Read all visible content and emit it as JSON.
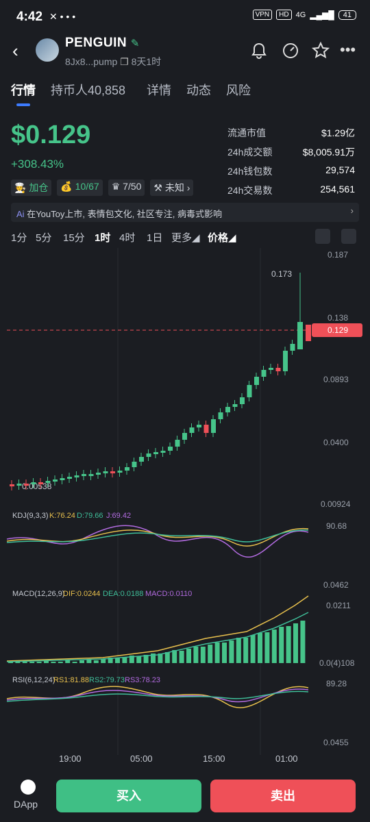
{
  "status": {
    "time": "4:42",
    "vpn": "VPN",
    "hd": "HD",
    "net": "4G",
    "battery": "41"
  },
  "token": {
    "name": "PENGUIN",
    "address": "8Jx8...pump",
    "age": "8天1时"
  },
  "tabs": [
    "行情",
    "持币人40,858",
    "详情",
    "动态",
    "风险"
  ],
  "price": {
    "value": "$0.129",
    "change": "+308.43%"
  },
  "badges": [
    "加仓",
    "10/67",
    "7/50",
    "未知"
  ],
  "stats": [
    {
      "label": "流通市值",
      "value": "$1.29亿"
    },
    {
      "label": "24h成交额",
      "value": "$8,005.91万"
    },
    {
      "label": "24h钱包数",
      "value": "29,574"
    },
    {
      "label": "24h交易数",
      "value": "254,561"
    }
  ],
  "ai_text": "在YouToy上市, 表情包文化, 社区专注, 病毒式影响",
  "timeframes": [
    "1分",
    "5分",
    "15分",
    "1时",
    "4时",
    "1日",
    "更多",
    "价格"
  ],
  "chart_data": {
    "type": "candlestick",
    "price_axis": [
      "0.187",
      "0.138",
      "0.0893",
      "0.0400",
      "0.00924"
    ],
    "current_price": "0.129",
    "high_label": "0.173",
    "low_label": "0.00538",
    "time_axis": [
      "19:00",
      "05:00",
      "15:00",
      "01:00"
    ],
    "kdj": {
      "label": "KDJ(9,3,3)",
      "k": "K:76.24",
      "d": "D:79.66",
      "j": "J:69.42",
      "max": "90.68",
      "min": "0.0462"
    },
    "macd": {
      "label": "MACD(12,26,9)",
      "dif": "DIF:0.0244",
      "dea": "DEA:0.0188",
      "macd": "MACD:0.0110",
      "max": "0.0211",
      "min": "0.0(4)108"
    },
    "rsi": {
      "label": "RSI(6,12,24)",
      "rs1": "RS1:81.88",
      "rs2": "RS2:79.73",
      "rs3": "RS3:78.23",
      "max": "89.28",
      "min": "0.0455"
    }
  },
  "buttons": {
    "buy": "买入",
    "sell": "卖出",
    "dapp": "DApp"
  },
  "colors": {
    "up": "#46c48a",
    "down": "#ef5058",
    "accent": "#3d7bfd"
  }
}
